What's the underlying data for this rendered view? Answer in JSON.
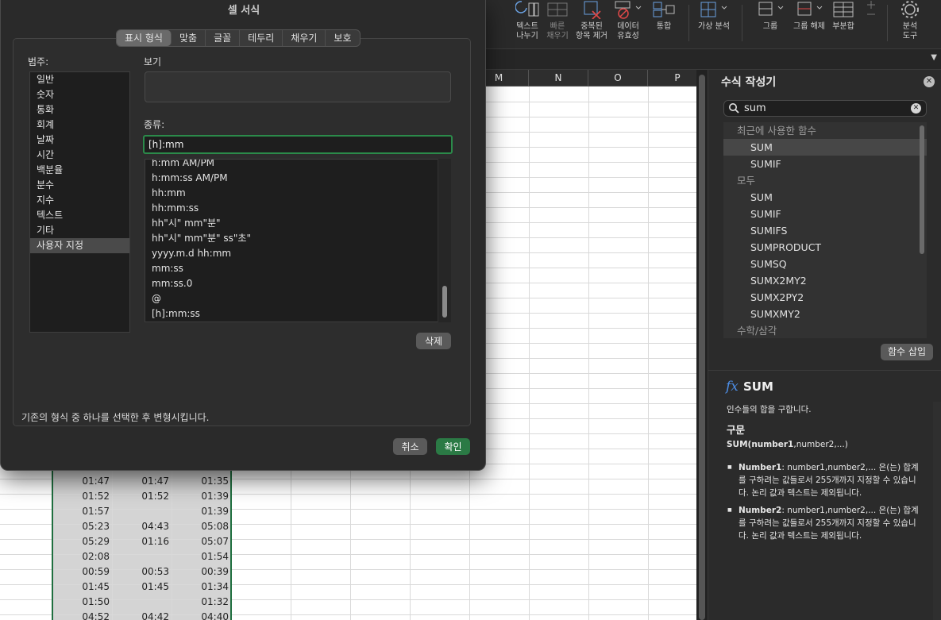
{
  "ribbon": {
    "buttons": [
      {
        "line1": "텍스트",
        "line2": "나누기",
        "icon": "text-to-columns-icon"
      },
      {
        "line1": "빠른",
        "line2": "채우기",
        "icon": "flash-fill-icon"
      },
      {
        "line1": "중복된",
        "line2": "항목 제거",
        "icon": "remove-duplicates-icon"
      },
      {
        "line1": "데이터",
        "line2": "유효성",
        "icon": "data-validation-icon"
      },
      {
        "line1": "통합",
        "line2": "",
        "icon": "consolidate-icon"
      },
      {
        "line1": "가상 분석",
        "line2": "",
        "icon": "what-if-analysis-icon"
      },
      {
        "line1": "그룹",
        "line2": "",
        "icon": "group-icon"
      },
      {
        "line1": "그룹 해제",
        "line2": "",
        "icon": "ungroup-icon"
      },
      {
        "line1": "부분합",
        "line2": "",
        "icon": "subtotal-icon"
      },
      {
        "line1": "분석",
        "line2": "도구",
        "icon": "analysis-tools-icon"
      }
    ]
  },
  "sheet": {
    "columns": [
      "M",
      "N",
      "O",
      "P"
    ],
    "rows": [
      [
        "01:47",
        "01:47",
        "01:35"
      ],
      [
        "01:52",
        "01:52",
        "01:39"
      ],
      [
        "01:57",
        "",
        "01:39"
      ],
      [
        "05:23",
        "04:43",
        "05:08"
      ],
      [
        "05:29",
        "01:16",
        "05:07"
      ],
      [
        "02:08",
        "",
        "01:54"
      ],
      [
        "00:59",
        "00:53",
        "00:39"
      ],
      [
        "01:45",
        "01:45",
        "01:34"
      ],
      [
        "01:50",
        "",
        "01:32"
      ],
      [
        "04:52",
        "04:42",
        "04:40"
      ]
    ]
  },
  "formula_builder": {
    "title": "수식 작성기",
    "search_value": "sum",
    "list": [
      {
        "kind": "group",
        "label": "최근에 사용한 함수"
      },
      {
        "kind": "item",
        "label": "SUM",
        "selected": true
      },
      {
        "kind": "item",
        "label": "SUMIF"
      },
      {
        "kind": "group",
        "label": "모두"
      },
      {
        "kind": "item",
        "label": "SUM"
      },
      {
        "kind": "item",
        "label": "SUMIF"
      },
      {
        "kind": "item",
        "label": "SUMIFS"
      },
      {
        "kind": "item",
        "label": "SUMPRODUCT"
      },
      {
        "kind": "item",
        "label": "SUMSQ"
      },
      {
        "kind": "item",
        "label": "SUMX2MY2"
      },
      {
        "kind": "item",
        "label": "SUMX2PY2"
      },
      {
        "kind": "item",
        "label": "SUMXMY2"
      },
      {
        "kind": "group",
        "label": "수학/삼각"
      }
    ],
    "insert_label": "함수 삽입",
    "fx": "fx",
    "function_name": "SUM",
    "description": "인수들의 합을 구합니다.",
    "syntax_heading": "구문",
    "syntax_bold": "SUM(number1",
    "syntax_rest": ",number2,...)",
    "args": [
      {
        "name": "Number1",
        "text": ": number1,number2,... 은(는) 합계를 구하려는 값들로서 255개까지 지정할 수 있습니다. 논리 값과 텍스트는 제외됩니다."
      },
      {
        "name": "Number2",
        "text": ": number1,number2,... 은(는) 합계를 구하려는 값들로서 255개까지 지정할 수 있습니다. 논리 값과 텍스트는 제외됩니다."
      }
    ]
  },
  "dialog": {
    "title": "셀 서식",
    "tabs": [
      "표시 형식",
      "맞춤",
      "글꼴",
      "테두리",
      "채우기",
      "보호"
    ],
    "active_tab": 0,
    "category_label": "범주:",
    "categories": [
      "일반",
      "숫자",
      "통화",
      "회계",
      "날짜",
      "시간",
      "백분율",
      "분수",
      "지수",
      "텍스트",
      "기타",
      "사용자 지정"
    ],
    "selected_category": 11,
    "preview_label": "보기",
    "type_label": "종류:",
    "type_value": "[h]:mm",
    "formats": [
      "h:mm AM/PM",
      "h:mm:ss AM/PM",
      "hh:mm",
      "hh:mm:ss",
      "hh\"시\" mm\"분\"",
      "hh\"시\" mm\"분\" ss\"초\"",
      "yyyy.m.d hh:mm",
      "mm:ss",
      "mm:ss.0",
      "@",
      "[h]:mm:ss"
    ],
    "delete_label": "삭제",
    "hint": "기존의 형식 중 하나를 선택한 후 변형시킵니다.",
    "cancel_label": "취소",
    "ok_label": "확인"
  },
  "colors": {
    "accent_green": "#2b7a45",
    "focus_green": "#2b8a4a",
    "fx_blue": "#4d8ee6"
  }
}
